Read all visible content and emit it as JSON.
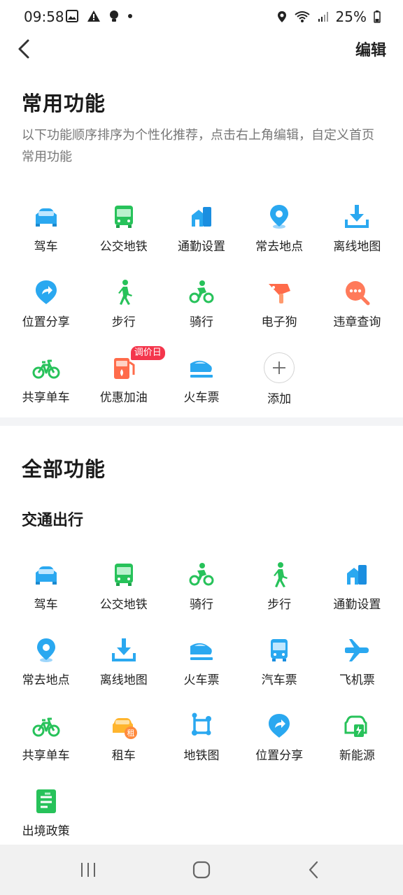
{
  "status_bar": {
    "time": "09:58",
    "battery": "25%"
  },
  "header": {
    "edit_label": "编辑"
  },
  "common": {
    "title": "常用功能",
    "description": "以下功能顺序排序为个性化推荐，点击右上角编辑，自定义首页常用功能",
    "items": [
      {
        "label": "驾车",
        "icon": "car-icon"
      },
      {
        "label": "公交地铁",
        "icon": "bus-icon"
      },
      {
        "label": "通勤设置",
        "icon": "commute-icon"
      },
      {
        "label": "常去地点",
        "icon": "location-pin-icon"
      },
      {
        "label": "离线地图",
        "icon": "download-icon"
      },
      {
        "label": "位置分享",
        "icon": "share-location-icon"
      },
      {
        "label": "步行",
        "icon": "walk-icon"
      },
      {
        "label": "骑行",
        "icon": "bike-ride-icon"
      },
      {
        "label": "电子狗",
        "icon": "speed-camera-icon"
      },
      {
        "label": "违章查询",
        "icon": "violation-search-icon"
      },
      {
        "label": "共享单车",
        "icon": "bicycle-icon"
      },
      {
        "label": "优惠加油",
        "icon": "fuel-icon",
        "badge": "调价日"
      },
      {
        "label": "火车票",
        "icon": "train-icon"
      },
      {
        "label": "添加",
        "icon": "plus-icon"
      }
    ]
  },
  "all": {
    "title": "全部功能",
    "category": "交通出行",
    "items": [
      {
        "label": "驾车",
        "icon": "car-icon"
      },
      {
        "label": "公交地铁",
        "icon": "bus-icon"
      },
      {
        "label": "骑行",
        "icon": "bike-ride-icon"
      },
      {
        "label": "步行",
        "icon": "walk-icon"
      },
      {
        "label": "通勤设置",
        "icon": "commute-icon"
      },
      {
        "label": "常去地点",
        "icon": "location-pin-icon"
      },
      {
        "label": "离线地图",
        "icon": "download-icon"
      },
      {
        "label": "火车票",
        "icon": "train-icon"
      },
      {
        "label": "汽车票",
        "icon": "coach-icon"
      },
      {
        "label": "飞机票",
        "icon": "plane-icon"
      },
      {
        "label": "共享单车",
        "icon": "bicycle-icon"
      },
      {
        "label": "租车",
        "icon": "rent-car-icon",
        "icon_text": "租"
      },
      {
        "label": "地铁图",
        "icon": "subway-map-icon"
      },
      {
        "label": "位置分享",
        "icon": "share-location-icon"
      },
      {
        "label": "新能源",
        "icon": "ev-charger-icon"
      },
      {
        "label": "出境政策",
        "icon": "exit-policy-icon"
      }
    ]
  },
  "colors": {
    "blue": "#2aa8f0",
    "green": "#27c25a",
    "orange": "#ff8a3d",
    "badge": "#f4364c"
  }
}
